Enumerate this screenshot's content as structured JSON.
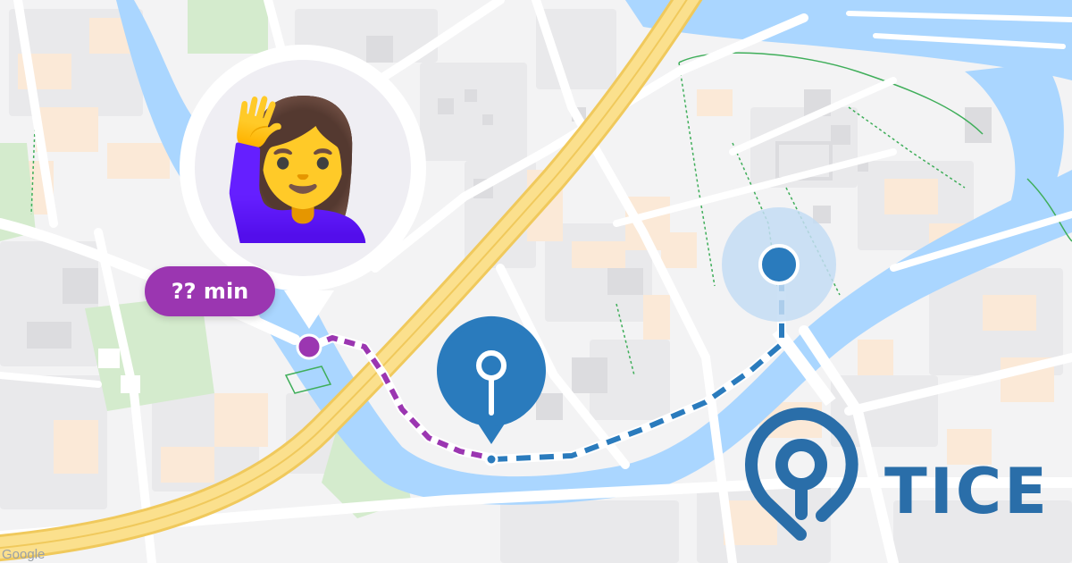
{
  "map": {
    "attribution": "Google",
    "colors": {
      "land": "#f3f3f4",
      "block": "#e8e8ea",
      "building": "#dedee1",
      "residential": "#fbe9d7",
      "park": "#d6eccf",
      "water": "#aad6ff",
      "road": "#ffffff",
      "highway": "#fbe08d",
      "highway_edge": "#f0c95c",
      "green_line": "#3fae5a"
    }
  },
  "user": {
    "avatar_icon": "woman-raising-hand-icon",
    "avatar_emoji": "🙋‍♀️",
    "eta_label": "?? min",
    "color": "#9b36b1"
  },
  "meeting_point": {
    "icon": "meeting-point-pin-icon",
    "color": "#2a7bbd"
  },
  "destination": {
    "icon": "destination-location-icon",
    "color": "#2a7bbd",
    "halo_color": "#c3dcf3"
  },
  "brand": {
    "name": "TICE",
    "logo_icon": "tice-logo-icon",
    "color": "#2a6ea9"
  }
}
